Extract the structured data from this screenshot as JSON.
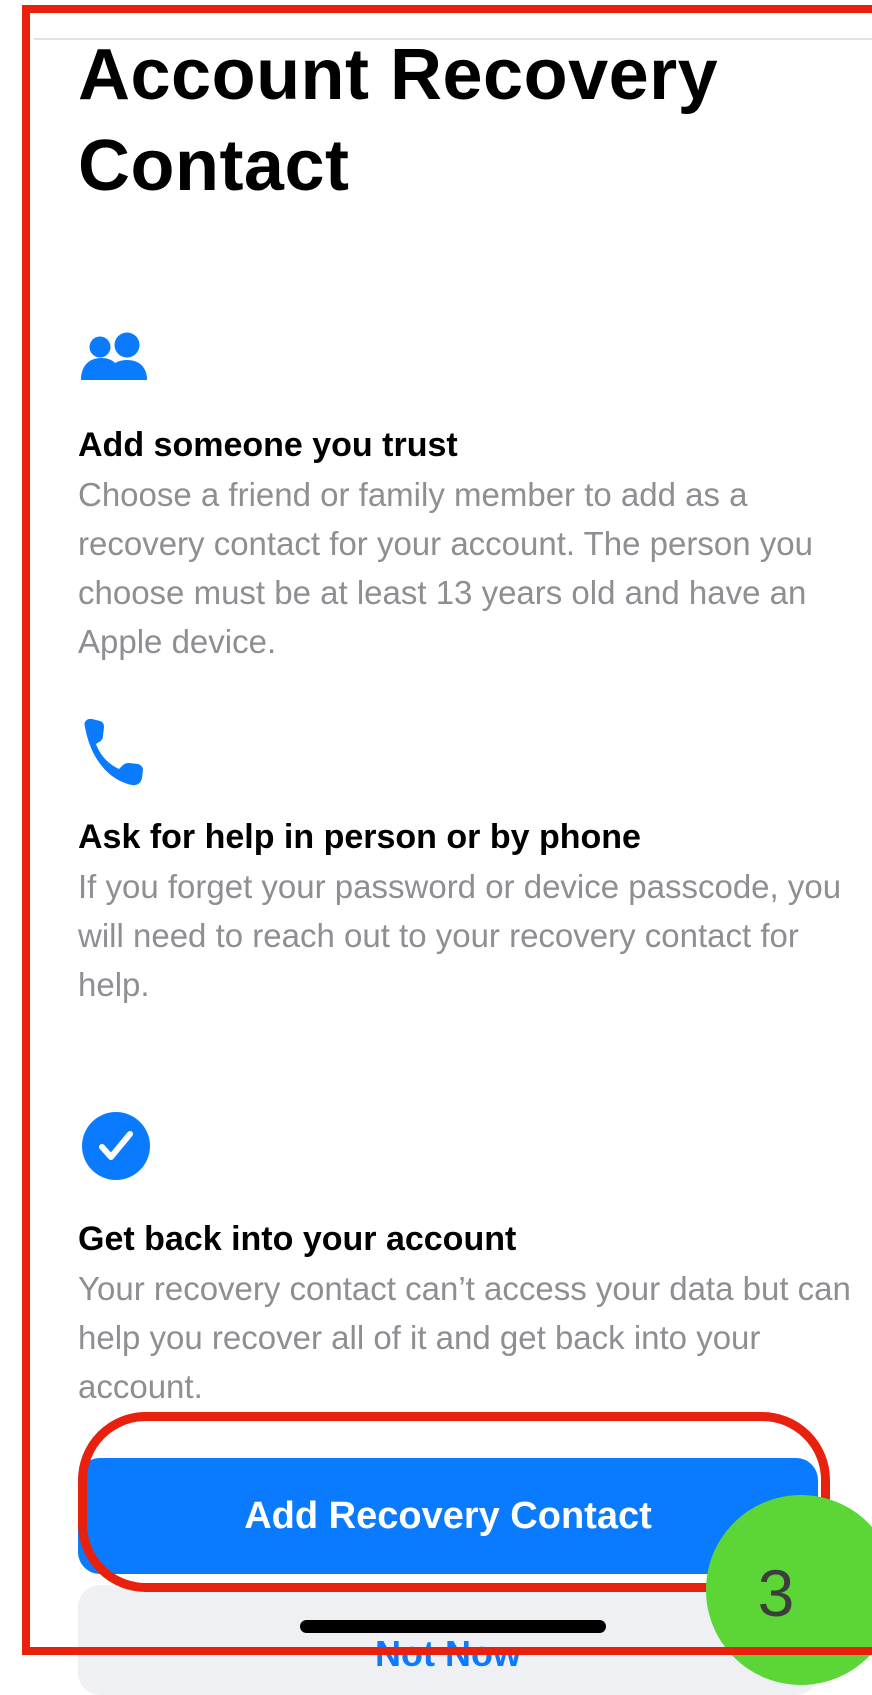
{
  "page": {
    "title": "Account Recovery Contact"
  },
  "sections": [
    {
      "icon": "people-icon",
      "heading": "Add someone you trust",
      "description": "Choose a friend or family member to add as a recovery contact for your account. The person you choose must be at least 13 years old and have an Apple device."
    },
    {
      "icon": "phone-icon",
      "heading": "Ask for help in person or by phone",
      "description": "If you forget your password or device passcode, you will need to reach out to your recovery contact for help."
    },
    {
      "icon": "checkmark-circle-icon",
      "heading": "Get back into your account",
      "description": "Your recovery contact can’t access your data but can help you recover all of it and get back into your account."
    }
  ],
  "actions": {
    "primary_label": "Add Recovery Contact",
    "secondary_label": "Not Now"
  },
  "annotation": {
    "step_number": "3",
    "highlight_color": "#e8210f",
    "badge_color": "#5cd636"
  },
  "colors": {
    "accent": "#0a7afe",
    "secondary_text": "#8e8e93"
  }
}
